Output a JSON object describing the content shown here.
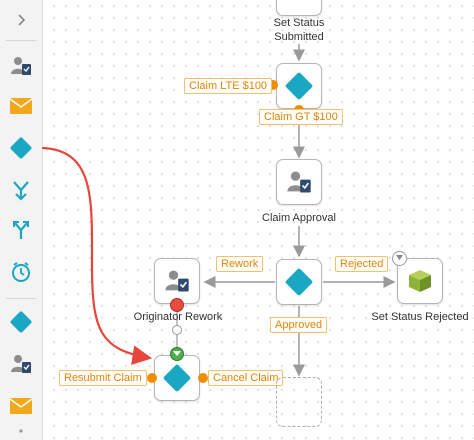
{
  "palette": {
    "items": [
      {
        "icon": "chevron-right-icon"
      },
      {
        "icon": "user-task-icon"
      },
      {
        "icon": "email-icon"
      },
      {
        "icon": "decision-diamond-icon"
      },
      {
        "icon": "merge-arrow-icon"
      },
      {
        "icon": "split-arrow-icon"
      },
      {
        "icon": "timer-icon"
      },
      {
        "icon": "decision-diamond-icon"
      },
      {
        "icon": "user-task-icon"
      },
      {
        "icon": "email-icon"
      }
    ]
  },
  "nodes": {
    "set_status_submitted": "Set Status\nSubmitted",
    "claim_approval": "Claim Approval",
    "originator_rework": "Originator Rework",
    "set_status_rejected": "Set Status Rejected"
  },
  "edge_labels": {
    "claim_lte": "Claim LTE $100",
    "claim_gt": "Claim GT $100",
    "rework": "Rework",
    "rejected": "Rejected",
    "approved": "Approved",
    "resubmit_claim": "Resubmit Claim",
    "cancel_claim": "Cancel Claim"
  },
  "colors": {
    "accent": "#1aa7c2",
    "orange": "#f28c00",
    "drag_arrow": "#e8463a",
    "green": "#4caf50",
    "red": "#e74c3c",
    "olive": "#8db33a"
  }
}
